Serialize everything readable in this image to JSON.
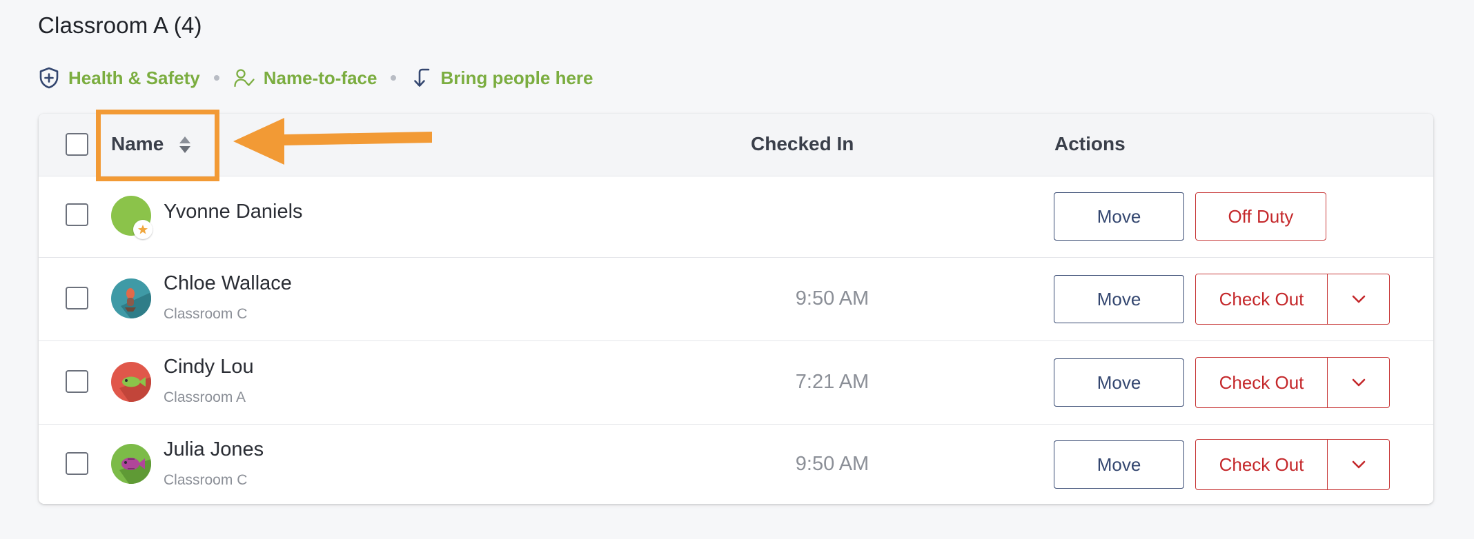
{
  "header": {
    "title": "Classroom A (4)"
  },
  "quick_links": [
    {
      "label": "Health & Safety",
      "icon": "shield-plus-icon"
    },
    {
      "label": "Name-to-face",
      "icon": "user-check-icon"
    },
    {
      "label": "Bring people here",
      "icon": "arrow-turn-down-icon"
    }
  ],
  "table": {
    "columns": {
      "name": "Name",
      "checked_in": "Checked In",
      "actions": "Actions"
    },
    "rows": [
      {
        "name": "Yvonne Daniels",
        "room": "",
        "time": "",
        "move_label": "Move",
        "action_label": "Off Duty",
        "avatar_color": "#8bc34a",
        "badge": "star-icon"
      },
      {
        "name": "Chloe Wallace",
        "room": "Classroom C",
        "time": "9:50 AM",
        "move_label": "Move",
        "action_label": "Check Out",
        "avatar_color": "#3f9aa6"
      },
      {
        "name": "Cindy Lou",
        "room": "Classroom A",
        "time": "7:21 AM",
        "move_label": "Move",
        "action_label": "Check Out",
        "avatar_color": "#e0574a"
      },
      {
        "name": "Julia Jones",
        "room": "Classroom C",
        "time": "9:50 AM",
        "move_label": "Move",
        "action_label": "Check Out",
        "avatar_color": "#7cbb48"
      }
    ]
  },
  "colors": {
    "accent_green": "#7bad40",
    "move_border": "#33466f",
    "danger_red": "#c4272a",
    "annotation_orange": "#f29a35"
  }
}
